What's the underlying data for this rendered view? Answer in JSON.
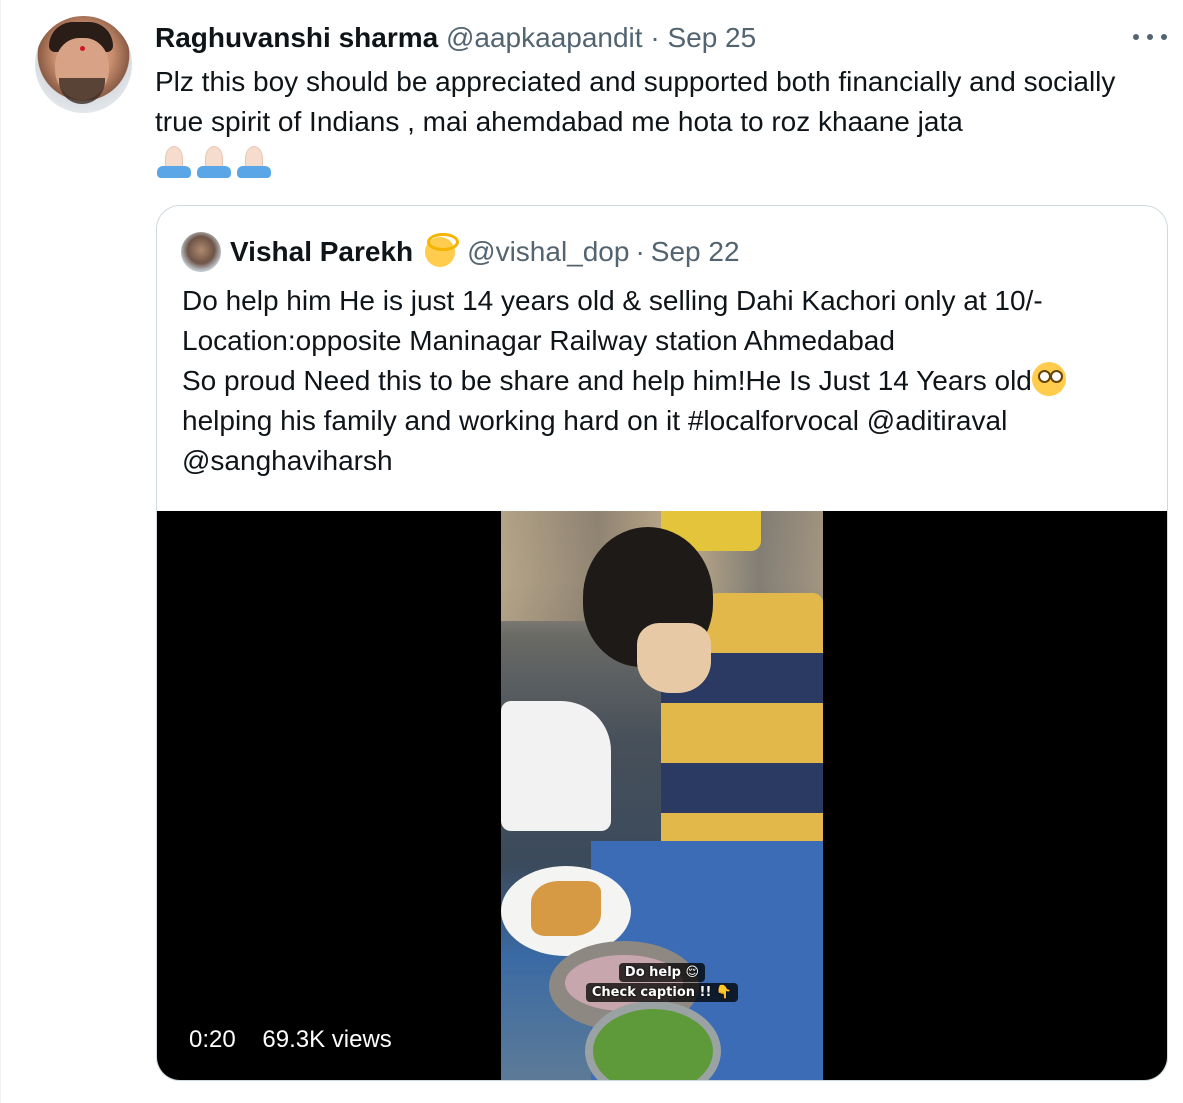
{
  "tweet": {
    "author_name": "Raghuvanshi sharma",
    "author_handle": "@aapkaapandit",
    "separator": "·",
    "date": "Sep 25",
    "text": "Plz this boy should be appreciated and supported both financially and socially true spirit of Indians , mai ahemdabad me hota to roz khaane jata",
    "emoji": "folded-hands-light-skin-tone x3",
    "more_icon": "more-horizontal-icon"
  },
  "quoted_tweet": {
    "author_name": "Vishal Parekh",
    "author_emoji": "man-with-turban-emoji",
    "author_handle": "@vishal_dop",
    "separator": "·",
    "date": "Sep 22",
    "lines": [
      "Do help him He is just 14 years old & selling Dahi Kachori only at 10/-",
      "Location:opposite Maninagar Railway station Ahmedabad",
      "So proud Need this to be share and help him!He Is Just 14 Years old",
      "helping his family and working hard on it #localforvocal @aditiraval",
      "@sanghaviharsh"
    ],
    "inline_emoji": "face-with-rolling-eyes-emoji",
    "video": {
      "caption_line1": "Do help 😌",
      "caption_line2": "Check caption !! 👇",
      "duration": "0:20",
      "views": "69.3K views"
    }
  }
}
